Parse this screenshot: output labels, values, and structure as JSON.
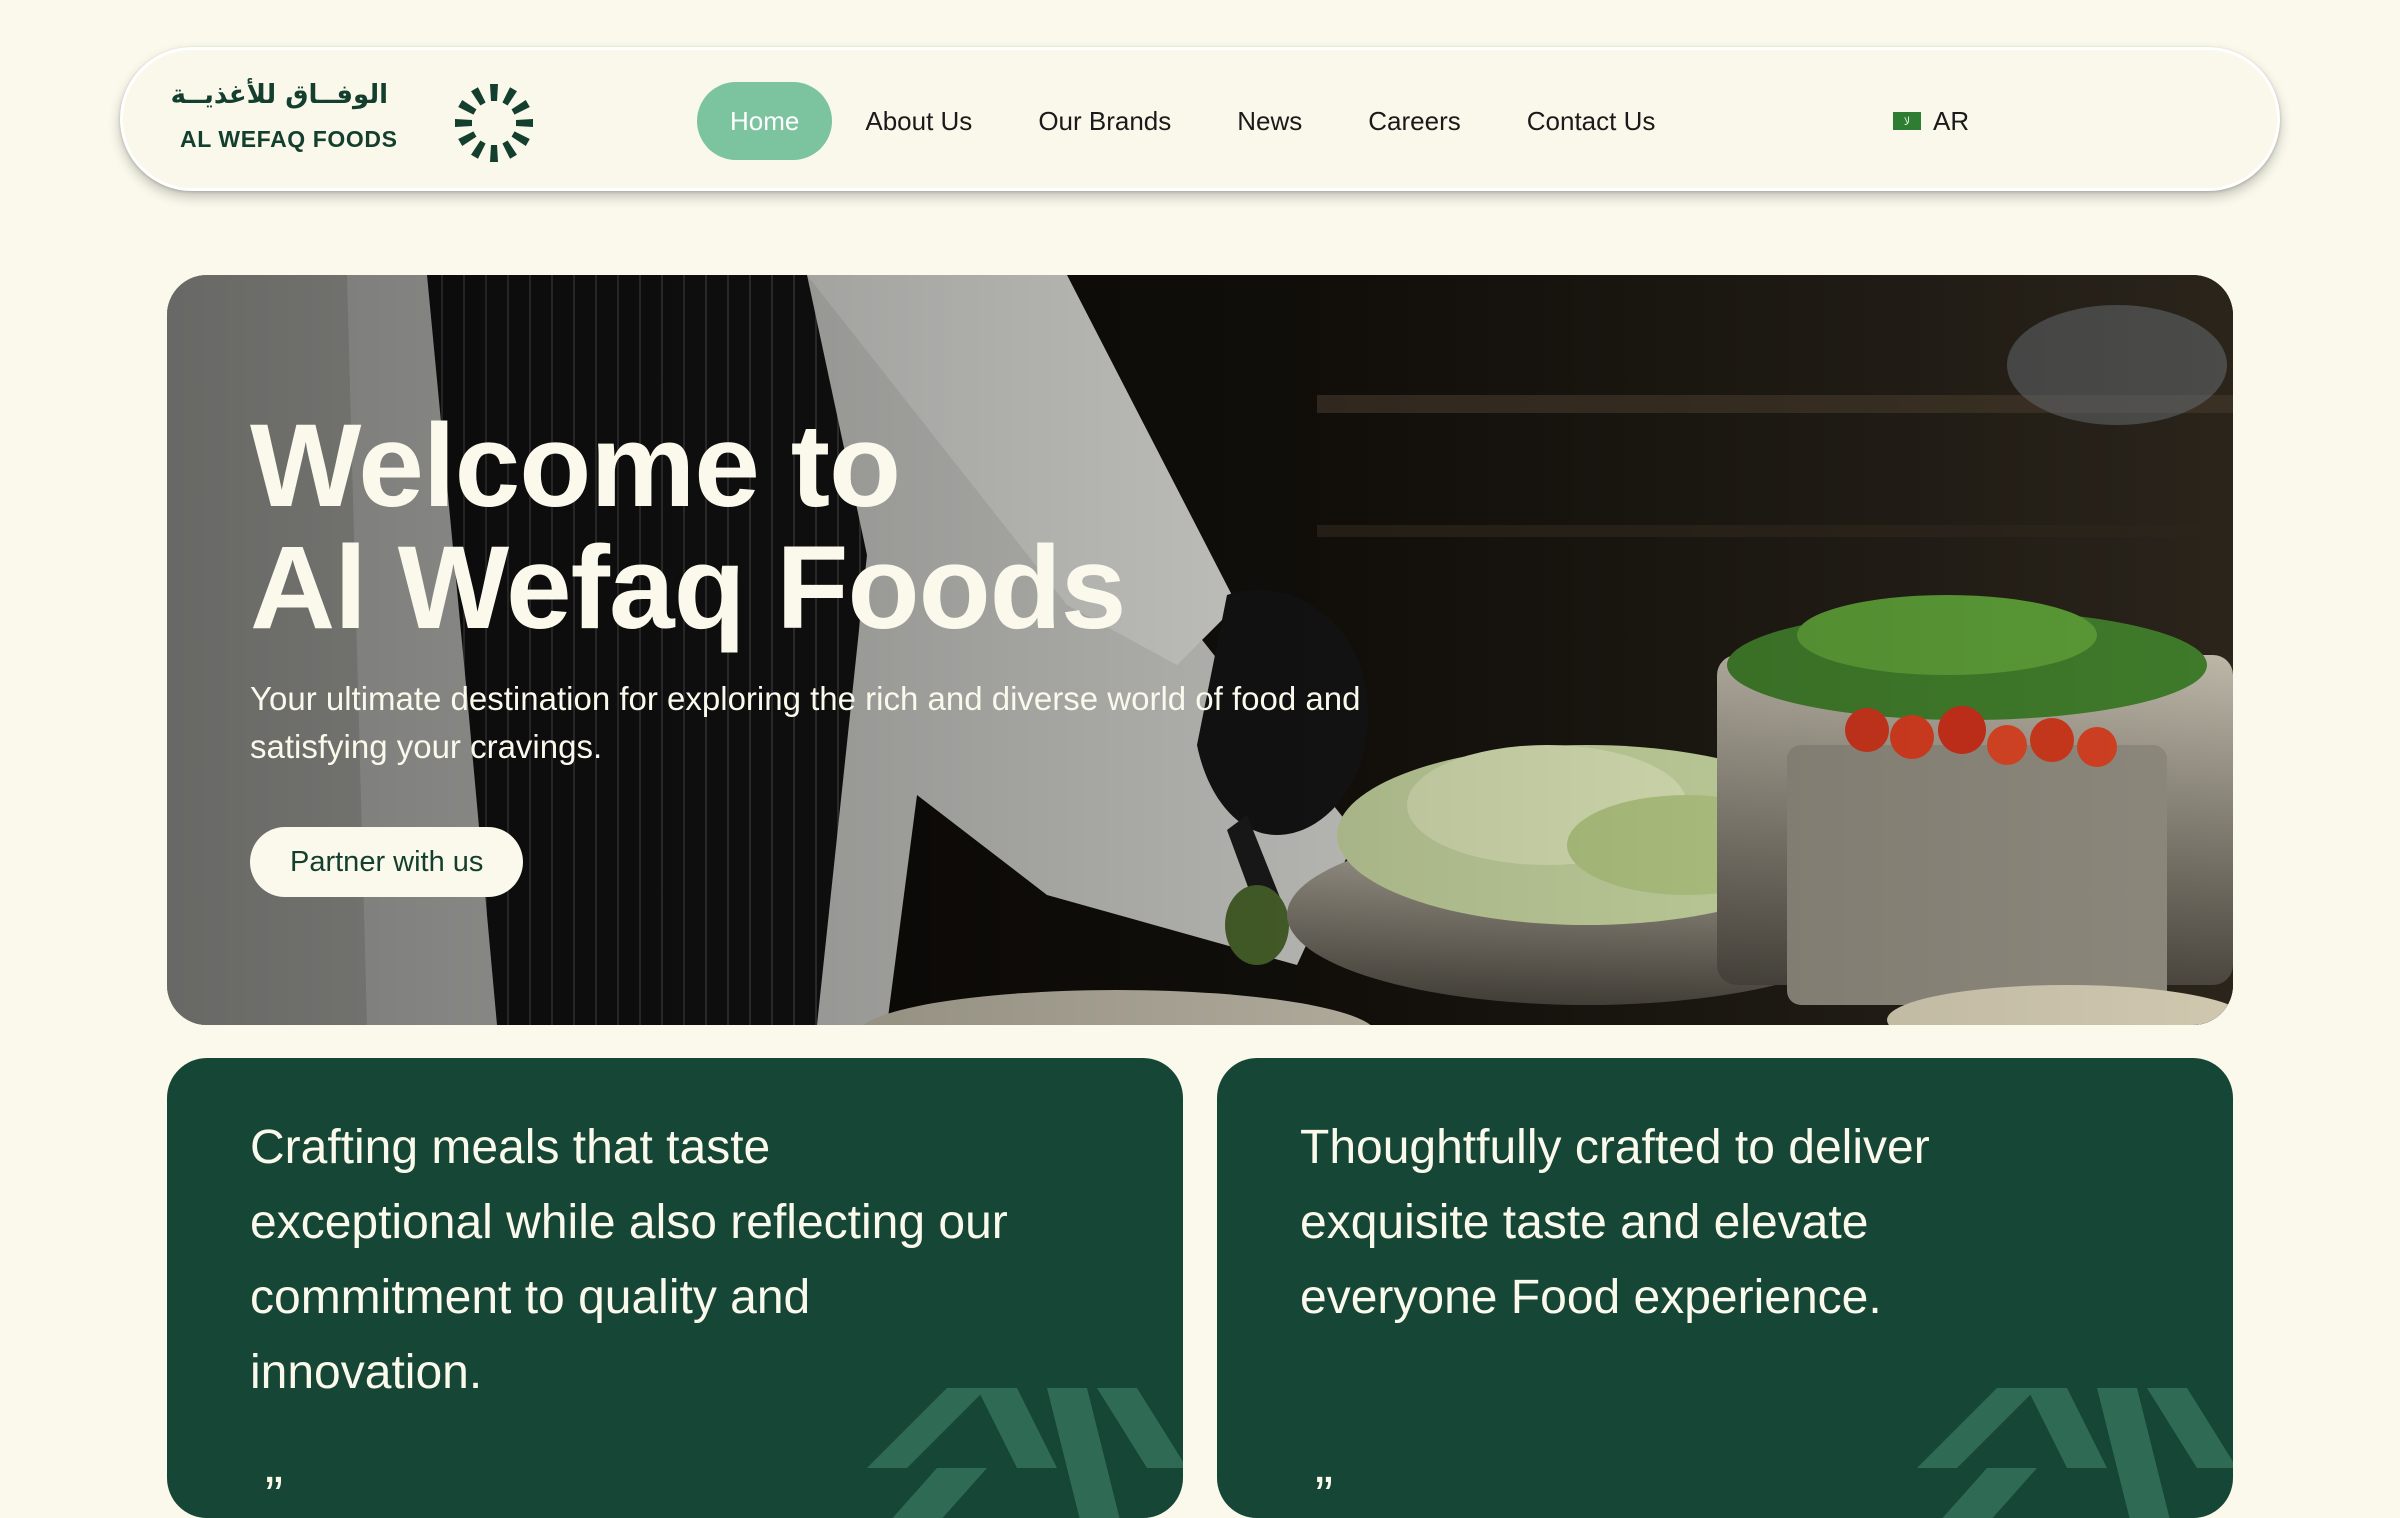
{
  "brand": {
    "name_ar": "الوفــاق للأغذيــة",
    "name_en": "AL WEFAQ FOODS"
  },
  "nav": {
    "items": [
      {
        "label": "Home",
        "active": true
      },
      {
        "label": "About Us"
      },
      {
        "label": "Our Brands"
      },
      {
        "label": "News"
      },
      {
        "label": "Careers"
      },
      {
        "label": "Contact Us"
      }
    ],
    "language": {
      "label": "AR",
      "flag_icon": "saudi-flag-icon"
    }
  },
  "hero": {
    "title_line1": "Welcome to",
    "title_line2": "Al Wefaq Foods",
    "subtitle": "Your ultimate destination for exploring the rich and diverse world of food and satisfying your cravings.",
    "cta_label": "Partner with us"
  },
  "cards": [
    {
      "text": "Crafting meals that taste exceptional while also reflecting our commitment to quality and innovation.",
      "quote": "”"
    },
    {
      "text": "Thoughtfully crafted to deliver exquisite taste and elevate everyone Food experience.",
      "quote": "”"
    }
  ],
  "colors": {
    "page_bg": "#faf9ec",
    "brand_green": "#164635",
    "accent_mint": "#7cc39f",
    "cream": "#faf9ec"
  }
}
